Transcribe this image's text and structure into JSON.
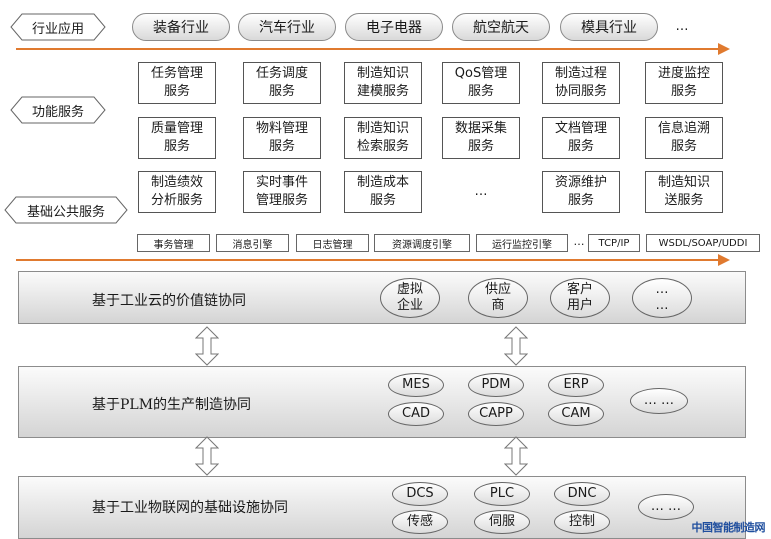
{
  "row_labels": {
    "industry": "行业应用",
    "function": "功能服务",
    "foundation": "基础公共服务"
  },
  "industries": [
    "装备行业",
    "汽车行业",
    "电子电器",
    "航空航天",
    "模具行业",
    "…"
  ],
  "services": [
    [
      "任务管理",
      "服务"
    ],
    [
      "任务调度",
      "服务"
    ],
    [
      "制造知识",
      "建模服务"
    ],
    [
      "QoS管理",
      "服务"
    ],
    [
      "制造过程",
      "协同服务"
    ],
    [
      "进度监控",
      "服务"
    ],
    [
      "质量管理",
      "服务"
    ],
    [
      "物料管理",
      "服务"
    ],
    [
      "制造知识",
      "检索服务"
    ],
    [
      "数据采集",
      "服务"
    ],
    [
      "文档管理",
      "服务"
    ],
    [
      "信息追溯",
      "服务"
    ],
    [
      "制造绩效",
      "分析服务"
    ],
    [
      "实时事件",
      "管理服务"
    ],
    [
      "制造成本",
      "服务"
    ],
    [
      "…",
      ""
    ],
    [
      "资源维护",
      "服务"
    ],
    [
      "制造知识",
      "送服务"
    ]
  ],
  "engines": [
    "事务管理",
    "消息引擎",
    "日志管理",
    "资源调度引擎",
    "运行监控引擎",
    "…",
    "TCP/IP",
    "WSDL/SOAP/UDDI"
  ],
  "layers": [
    {
      "title": "基于工业云的价值链协同",
      "items": [
        [
          "虚拟",
          "企业"
        ],
        [
          "供应",
          "商"
        ],
        [
          "客户",
          "用户"
        ],
        [
          "…",
          "…"
        ]
      ]
    },
    {
      "title": "基于PLM的生产制造协同",
      "items": [
        [
          "MES"
        ],
        [
          "PDM"
        ],
        [
          "ERP"
        ],
        [
          "CAD"
        ],
        [
          "CAPP"
        ],
        [
          "CAM"
        ],
        [
          "… …"
        ]
      ]
    },
    {
      "title": "基于工业物联网的基础设施协同",
      "items": [
        [
          "DCS"
        ],
        [
          "PLC"
        ],
        [
          "DNC"
        ],
        [
          "传感"
        ],
        [
          "伺服"
        ],
        [
          "控制"
        ],
        [
          "… …"
        ]
      ]
    }
  ],
  "watermark": "中国智能制造网",
  "colors": {
    "arrow": "#e07a2f",
    "pill_border": "#8a8a8a",
    "panel_border": "#8c8c8c"
  }
}
